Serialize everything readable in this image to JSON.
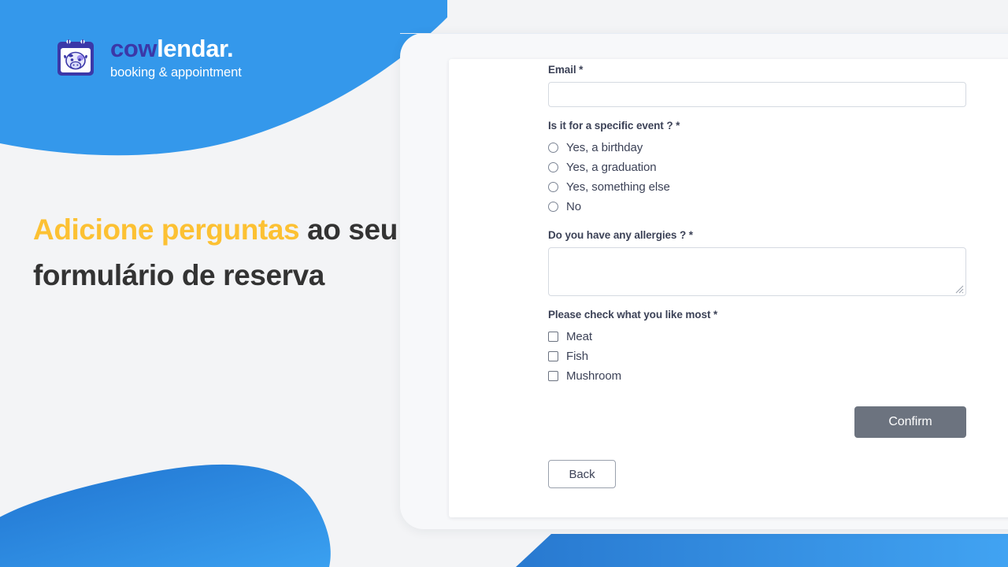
{
  "brand": {
    "logo_icon": "calendar-cow-icon",
    "name_part_one": "cow",
    "name_part_two": "lendar.",
    "tagline": "booking & appointment",
    "accent_blue": "#3498eb",
    "logo_indigo": "#3b38a8"
  },
  "hero": {
    "headline_accent": "Adicione perguntas",
    "headline_rest": "ao seu formulário de reserva",
    "accent_color": "#fcc133",
    "text_color": "#333333"
  },
  "form": {
    "email": {
      "label": "Email *",
      "value": "",
      "placeholder": ""
    },
    "event_question": {
      "label": "Is it for a specific event ? *",
      "options": [
        {
          "label": "Yes, a birthday",
          "checked": false
        },
        {
          "label": "Yes, a graduation",
          "checked": false
        },
        {
          "label": "Yes, something else",
          "checked": false
        },
        {
          "label": "No",
          "checked": false
        }
      ]
    },
    "allergies": {
      "label": "Do you have any allergies ? *",
      "value": "",
      "placeholder": ""
    },
    "likes": {
      "label": "Please check what you like most *",
      "options": [
        {
          "label": "Meat",
          "checked": false
        },
        {
          "label": "Fish",
          "checked": false
        },
        {
          "label": "Mushroom",
          "checked": false
        }
      ]
    },
    "confirm_label": "Confirm",
    "back_label": "Back",
    "confirm_color": "#6c737f"
  }
}
